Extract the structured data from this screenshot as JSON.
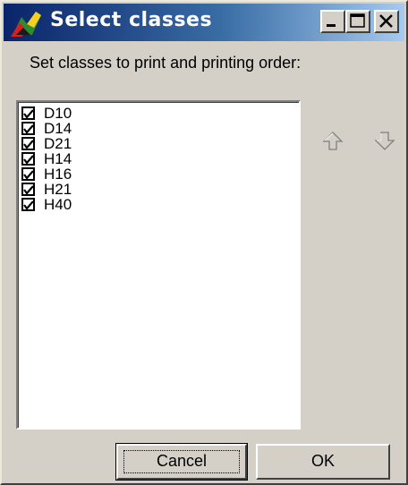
{
  "window": {
    "title": "Select classes",
    "icon": "app-icon",
    "controls": {
      "minimize_icon": "minimize-icon",
      "maximize_icon": "maximize-icon",
      "close_icon": "close-icon"
    }
  },
  "instruction": "Set classes to print and printing order:",
  "classes": [
    {
      "label": "D10",
      "checked": true
    },
    {
      "label": "D14",
      "checked": true
    },
    {
      "label": "D21",
      "checked": true
    },
    {
      "label": "H14",
      "checked": true
    },
    {
      "label": "H16",
      "checked": true
    },
    {
      "label": "H21",
      "checked": true
    },
    {
      "label": "H40",
      "checked": true
    }
  ],
  "order_controls": {
    "up_icon": "move-up-arrow-icon",
    "down_icon": "move-down-arrow-icon"
  },
  "buttons": {
    "cancel": "Cancel",
    "ok": "OK"
  },
  "colors": {
    "title_bar_start": "#0a246a",
    "title_bar_end": "#a6caf0",
    "dialog_face": "#d4d0c8"
  }
}
